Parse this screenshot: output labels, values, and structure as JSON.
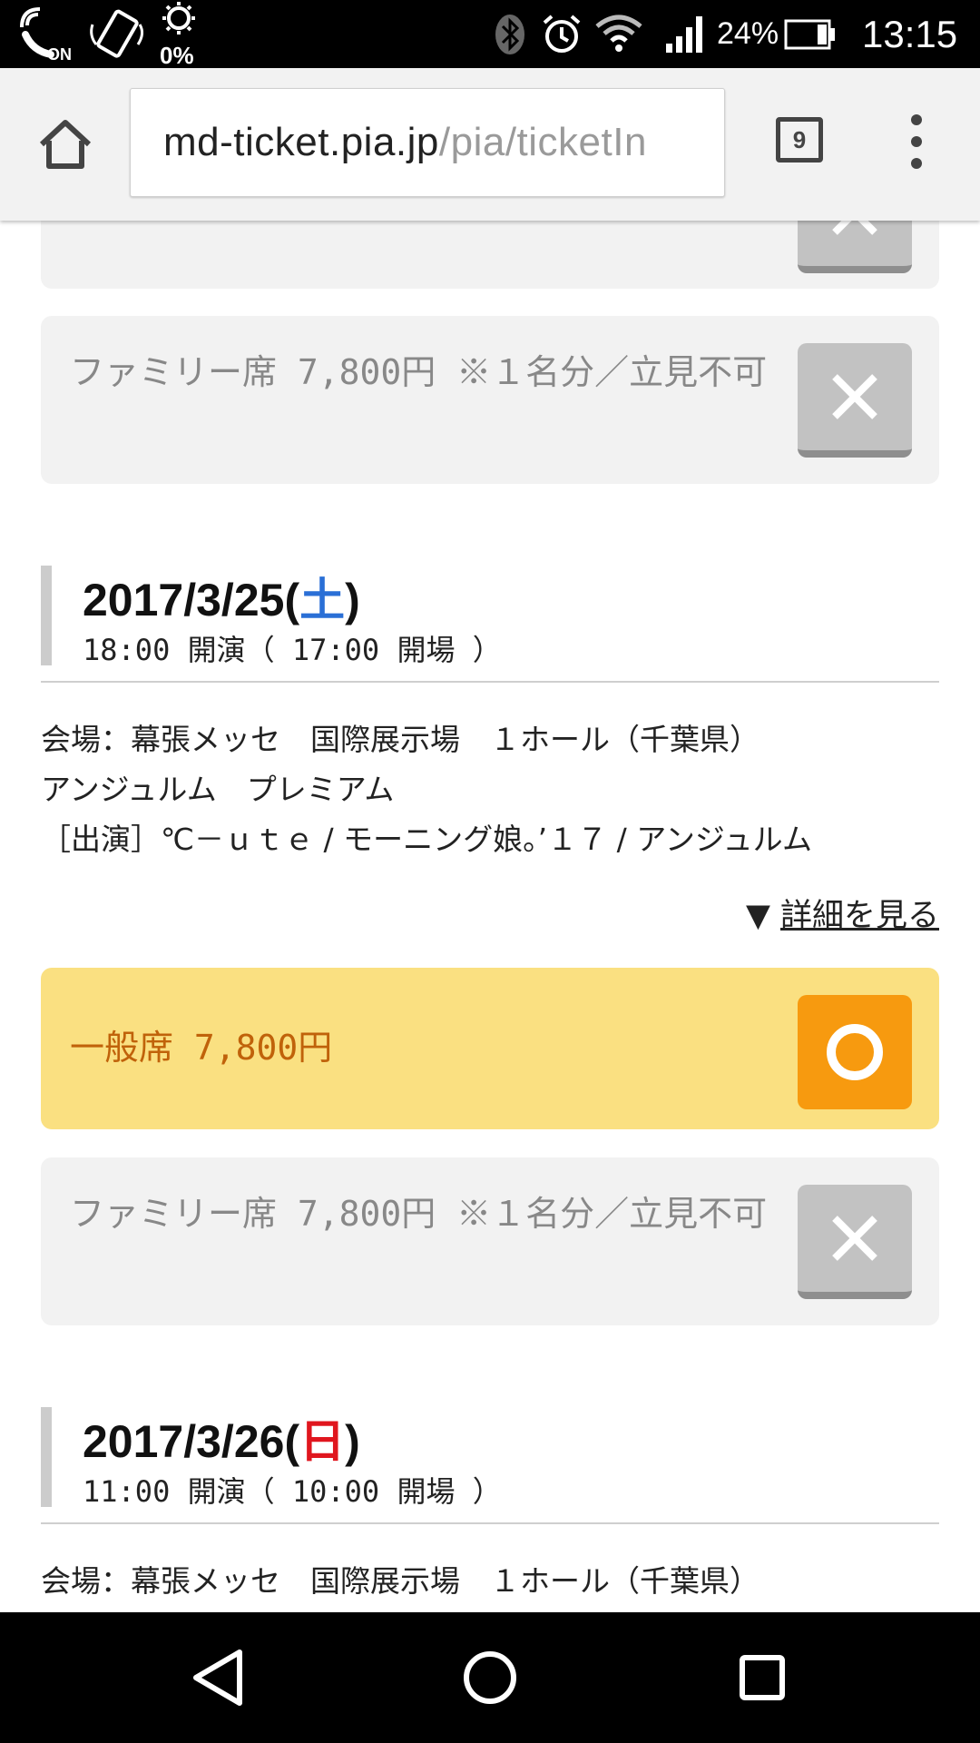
{
  "status_bar": {
    "nfc_label": "ON",
    "brightness_label": "0%",
    "battery_percent": "24%",
    "time": "13:15"
  },
  "browser": {
    "url_host": "md-ticket.pia.jp",
    "url_path": "/pia/ticketIn",
    "tab_count": "9"
  },
  "partial_top_card": {
    "status": "soldout"
  },
  "first_family_seat": {
    "label": "ファミリー席 7,800円 ※１名分／立見不可",
    "status": "soldout"
  },
  "events": [
    {
      "date": "2017/3/25",
      "day_of_week": "土",
      "time": "18:00 開演（ 17:00 開場 ）",
      "venue": "会場：幕張メッセ　国際展示場　１ホール（千葉県）",
      "title": "アンジュルム　プレミアム",
      "performers": "［出演］℃－ｕｔｅ / モーニング娘。’１７ / アンジュルム",
      "details_link": "詳細を見る",
      "seats": [
        {
          "label": "一般席 7,800円",
          "status": "available"
        },
        {
          "label": "ファミリー席 7,800円 ※１名分／立見不可",
          "status": "soldout"
        }
      ]
    },
    {
      "date": "2017/3/26",
      "day_of_week": "日",
      "time": "11:00 開演（ 10:00 開場 ）",
      "venue": "会場：幕張メッセ　国際展示場　１ホール（千葉県）"
    }
  ],
  "colors": {
    "available_bg": "#fae081",
    "available_text": "#c0620a",
    "open_button": "#f79a0f",
    "soldout_button": "#c2c2c2",
    "saturday": "#2a6fd6",
    "sunday": "#e0161e"
  },
  "icons": {
    "soldout": "cross-icon",
    "available": "circle-icon"
  }
}
